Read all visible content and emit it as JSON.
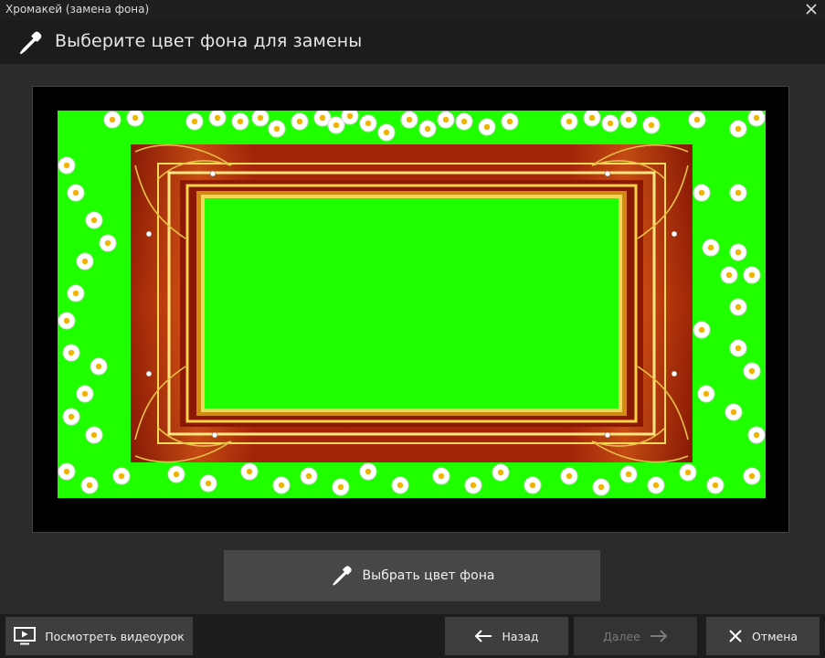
{
  "window": {
    "title": "Хромакей (замена фона)"
  },
  "header": {
    "title": "Выберите цвет фона для замены",
    "icon": "eyedropper-icon"
  },
  "preview": {
    "background_color": "#1fff00",
    "frame_color": "#b52a0a"
  },
  "pick_button": {
    "label": "Выбрать цвет фона",
    "icon": "eyedropper-icon"
  },
  "footer": {
    "tutorial_label": "Посмотреть видеоурок",
    "back_label": "Назад",
    "next_label": "Далее",
    "cancel_label": "Отмена"
  }
}
